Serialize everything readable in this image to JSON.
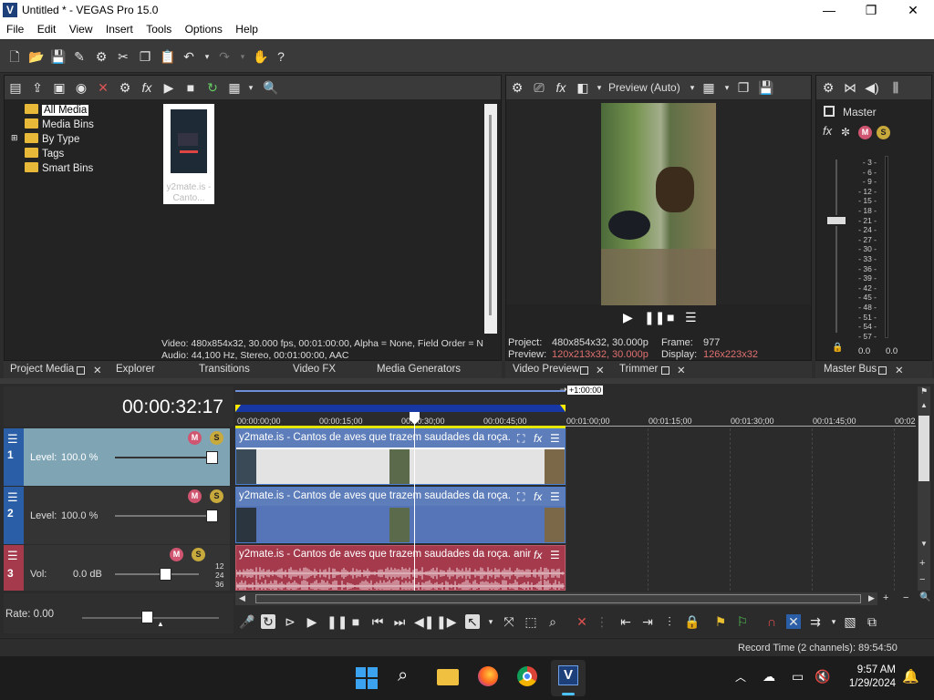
{
  "window": {
    "title": "Untitled * - VEGAS Pro 15.0",
    "app_icon": "V",
    "controls": [
      "—",
      "❐",
      "✕"
    ]
  },
  "menu": [
    "File",
    "Edit",
    "View",
    "Insert",
    "Tools",
    "Options",
    "Help"
  ],
  "project_media": {
    "tree": [
      {
        "label": "All Media",
        "selected": true,
        "expandable": false
      },
      {
        "label": "Media Bins",
        "selected": false,
        "expandable": false
      },
      {
        "label": "By Type",
        "selected": false,
        "expandable": true
      },
      {
        "label": "Tags",
        "selected": false,
        "expandable": false
      },
      {
        "label": "Smart Bins",
        "selected": false,
        "expandable": false
      }
    ],
    "thumbnail_caption_line1": "y2mate.is -",
    "thumbnail_caption_line2": "Canto...",
    "info_video": "Video: 480x854x32, 30.000 fps, 00:01:00:00, Alpha = None, Field Order = N",
    "info_audio": "Audio: 44,100 Hz, Stereo, 00:01:00:00, AAC"
  },
  "left_tabs": [
    "Project Media",
    "Explorer",
    "Transitions",
    "Video FX",
    "Media Generators"
  ],
  "preview": {
    "mode": "Preview (Auto)",
    "project_label": "Project:",
    "project_value": "480x854x32, 30.000p",
    "frame_label": "Frame:",
    "frame_value": "977",
    "preview_label": "Preview:",
    "preview_value": "120x213x32, 30.000p",
    "display_label": "Display:",
    "display_value": "126x223x32"
  },
  "preview_tabs": [
    "Video Preview",
    "Trimmer"
  ],
  "master": {
    "label": "Master",
    "scale": [
      "3",
      "6",
      "9",
      "12",
      "15",
      "18",
      "21",
      "24",
      "27",
      "30",
      "33",
      "36",
      "39",
      "42",
      "45",
      "48",
      "51",
      "54",
      "57"
    ],
    "left_value": "0.0",
    "right_value": "0.0",
    "tab": "Master Bus"
  },
  "timeline": {
    "timecode": "00:00:32:17",
    "loop_label": "+1:00:00",
    "ruler": [
      "00:00:00;00",
      "00:00:15;00",
      "00:00:30;00",
      "00:00:45;00",
      "00:01:00;00",
      "00:01:15;00",
      "00:01:30;00",
      "00:01:45;00",
      "00:02"
    ],
    "tracks": [
      {
        "number": "1",
        "type": "video",
        "param_label": "Level:",
        "param_value": "100.0 %",
        "clip_title": "y2mate.is - Cantos de aves que trazem saudades da roça. a..."
      },
      {
        "number": "2",
        "type": "video",
        "param_label": "Level:",
        "param_value": "100.0 %",
        "clip_title": "y2mate.is - Cantos de aves que trazem saudades da roça. a..."
      },
      {
        "number": "3",
        "type": "audio",
        "param_label": "Vol:",
        "param_value": "0.0 dB",
        "clip_title": "y2mate.is - Cantos de aves que trazem saudades da roça. anim...",
        "db_marks": [
          "12",
          "24",
          "36"
        ]
      }
    ],
    "rate_label": "Rate: 0.00"
  },
  "status": {
    "record_time": "Record Time (2 channels): 89:54:50"
  },
  "taskbar": {
    "time": "9:57 AM",
    "date": "1/29/2024",
    "apps": [
      "start-icon",
      "search-icon",
      "file-explorer-icon",
      "firefox-icon",
      "chrome-icon",
      "vegas-icon"
    ]
  },
  "colors": {
    "video_track_1": "#7fa4b4",
    "video_track_2": "#5674b8",
    "audio_track": "#a53a4d",
    "accent": "#3b6fd6"
  }
}
